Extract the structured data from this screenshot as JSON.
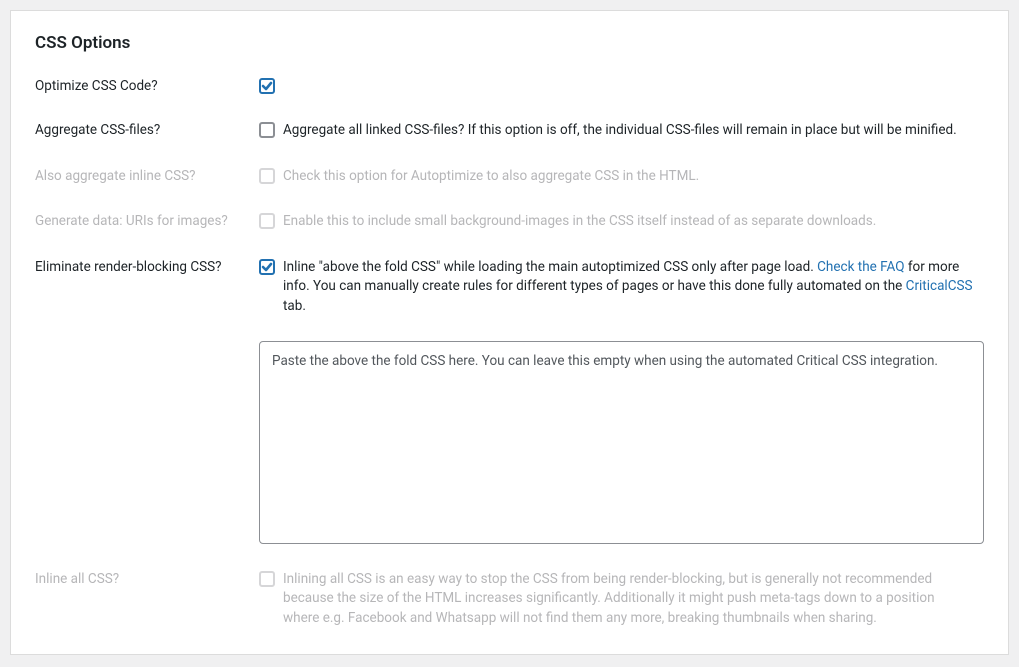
{
  "section_title": "CSS Options",
  "rows": {
    "optimize": {
      "label": "Optimize CSS Code?"
    },
    "aggregate": {
      "label": "Aggregate CSS-files?",
      "desc": "Aggregate all linked CSS-files? If this option is off, the individual CSS-files will remain in place but will be minified."
    },
    "aggregate_inline": {
      "label": "Also aggregate inline CSS?",
      "desc": "Check this option for Autoptimize to also aggregate CSS in the HTML."
    },
    "datauri": {
      "label": "Generate data: URIs for images?",
      "desc": "Enable this to include small background-images in the CSS itself instead of as separate downloads."
    },
    "renderblock": {
      "label": "Eliminate render-blocking CSS?",
      "desc_a": "Inline \"above the fold CSS\" while loading the main autoptimized CSS only after page load. ",
      "link1": "Check the FAQ",
      "desc_b": " for more info. You can manually create rules for different types of pages or have this done fully automated on the ",
      "link2": "CriticalCSS",
      "desc_c": " tab.",
      "placeholder": "Paste the above the fold CSS here. You can leave this empty when using the automated Critical CSS integration."
    },
    "inlineall": {
      "label": "Inline all CSS?",
      "desc": "Inlining all CSS is an easy way to stop the CSS from being render-blocking, but is generally not recommended because the size of the HTML increases significantly. Additionally it might push meta-tags down to a position where e.g. Facebook and Whatsapp will not find them any more, breaking thumbnails when sharing."
    }
  }
}
